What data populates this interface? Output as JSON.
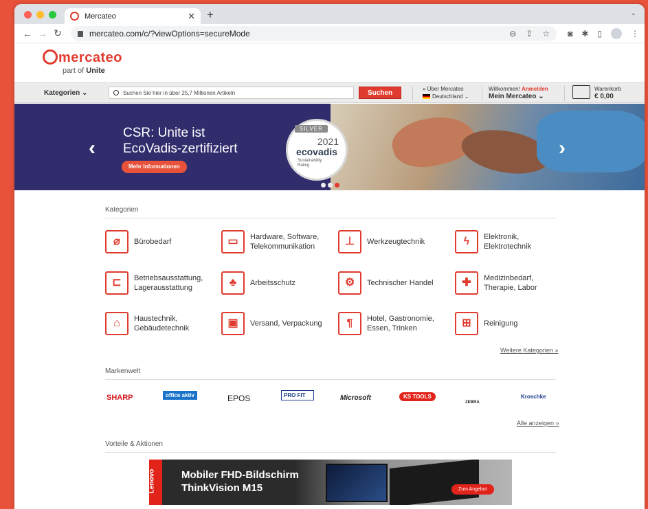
{
  "browser": {
    "tab_title": "Mercateo",
    "url": "mercateo.com/c/?viewOptions=secureMode"
  },
  "site": {
    "logo": "mercateo",
    "logo_sub_prefix": "part of",
    "logo_sub_brand": "Unite"
  },
  "toolbar": {
    "categories": "Kategorien",
    "search_placeholder": "Suchen Sie hier in über 25,7 Millionen Artikeln",
    "search_button": "Suchen",
    "about": "» Über Mercateo",
    "country": "Deutschland",
    "welcome": "Willkommen!",
    "login": "Anmelden",
    "my_account": "Mein Mercateo",
    "cart_label": "Warenkorb",
    "cart_amount": "€ 0,00"
  },
  "banner": {
    "title_line1": "CSR: Unite ist",
    "title_line2": "EcoVadis-zertifiziert",
    "button": "Mehr Informationen",
    "seal_level": "SILVER",
    "seal_year": "2021",
    "seal_brand": "ecovadis",
    "seal_sub1": "Sustainability",
    "seal_sub2": "Rating"
  },
  "categories": {
    "heading": "Kategorien",
    "items": [
      {
        "line1": "Bürobedarf",
        "line2": "",
        "icon": "paperclip-icon"
      },
      {
        "line1": "Hardware, Software,",
        "line2": "Telekommunikation",
        "icon": "laptop-icon"
      },
      {
        "line1": "Werkzeugtechnik",
        "line2": "",
        "icon": "drill-icon"
      },
      {
        "line1": "Elektronik,",
        "line2": "Elektrotechnik",
        "icon": "lightning-icon"
      },
      {
        "line1": "Betriebsausstattung,",
        "line2": "Lagerausstattung",
        "icon": "forklift-icon"
      },
      {
        "line1": "Arbeitsschutz",
        "line2": "",
        "icon": "hardhat-icon"
      },
      {
        "line1": "Technischer Handel",
        "line2": "",
        "icon": "gears-icon"
      },
      {
        "line1": "Medizinbedarf,",
        "line2": "Therapie, Labor",
        "icon": "medkit-icon"
      },
      {
        "line1": "Haustechnik,",
        "line2": "Gebäudetechnik",
        "icon": "house-icon"
      },
      {
        "line1": "Versand, Verpackung",
        "line2": "",
        "icon": "package-icon"
      },
      {
        "line1": "Hotel, Gastronomie,",
        "line2": "Essen, Trinken",
        "icon": "bottle-icon"
      },
      {
        "line1": "Reinigung",
        "line2": "",
        "icon": "cleaning-cart-icon"
      }
    ],
    "more": "Weitere Kategorien"
  },
  "brands": {
    "heading": "Markenwelt",
    "items": [
      "SHARP",
      "office aktiv",
      "EPOS",
      "PRO FIT",
      "Microsoft",
      "KS TOOLS",
      "ZEBRA",
      "Kroschke"
    ],
    "more": "Alle anzeigen"
  },
  "promos": {
    "heading": "Vorteile & Aktionen",
    "ad_brand": "Lenovo",
    "ad_line1": "Mobiler FHD-Bildschirm",
    "ad_line2": "ThinkVision M15",
    "ad_button": "Zum Angebot"
  }
}
